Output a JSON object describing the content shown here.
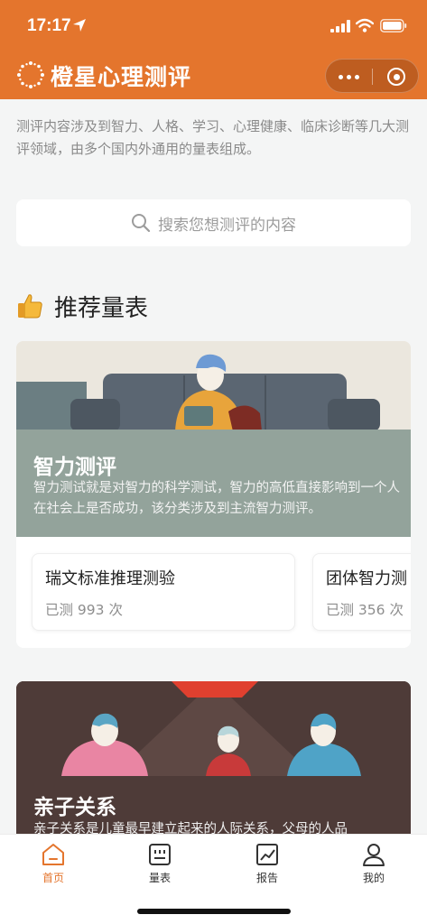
{
  "status_bar": {
    "time": "17:17"
  },
  "header": {
    "title": "橙星心理测评",
    "accent": "#e4752d"
  },
  "intro": "测评内容涉及到智力、人格、学习、心理健康、临床诊断等几大测评领域，由多个国内外通用的量表组成。",
  "search": {
    "placeholder": "搜索您想测评的内容"
  },
  "section": {
    "title": "推荐量表",
    "icon": "thumbs-up-icon"
  },
  "categories": [
    {
      "title": "智力测评",
      "desc": "智力测试就是对智力的科学测试，智力的高低直接影响到一个人在社会上是否成功，该分类涉及到主流智力测评。",
      "scales": [
        {
          "name": "瑞文标准推理测验",
          "count": "已测 993 次"
        },
        {
          "name": "团体智力测",
          "count": "已测 356 次"
        }
      ]
    },
    {
      "title": "亲子关系",
      "desc": "亲子关系是儿童最早建立起来的人际关系，父母的人品"
    }
  ],
  "tabbar": {
    "tabs": [
      {
        "label": "首页",
        "icon": "home-icon",
        "active": true
      },
      {
        "label": "量表",
        "icon": "scale-list-icon",
        "active": false
      },
      {
        "label": "报告",
        "icon": "report-chart-icon",
        "active": false
      },
      {
        "label": "我的",
        "icon": "profile-icon",
        "active": false
      }
    ]
  }
}
